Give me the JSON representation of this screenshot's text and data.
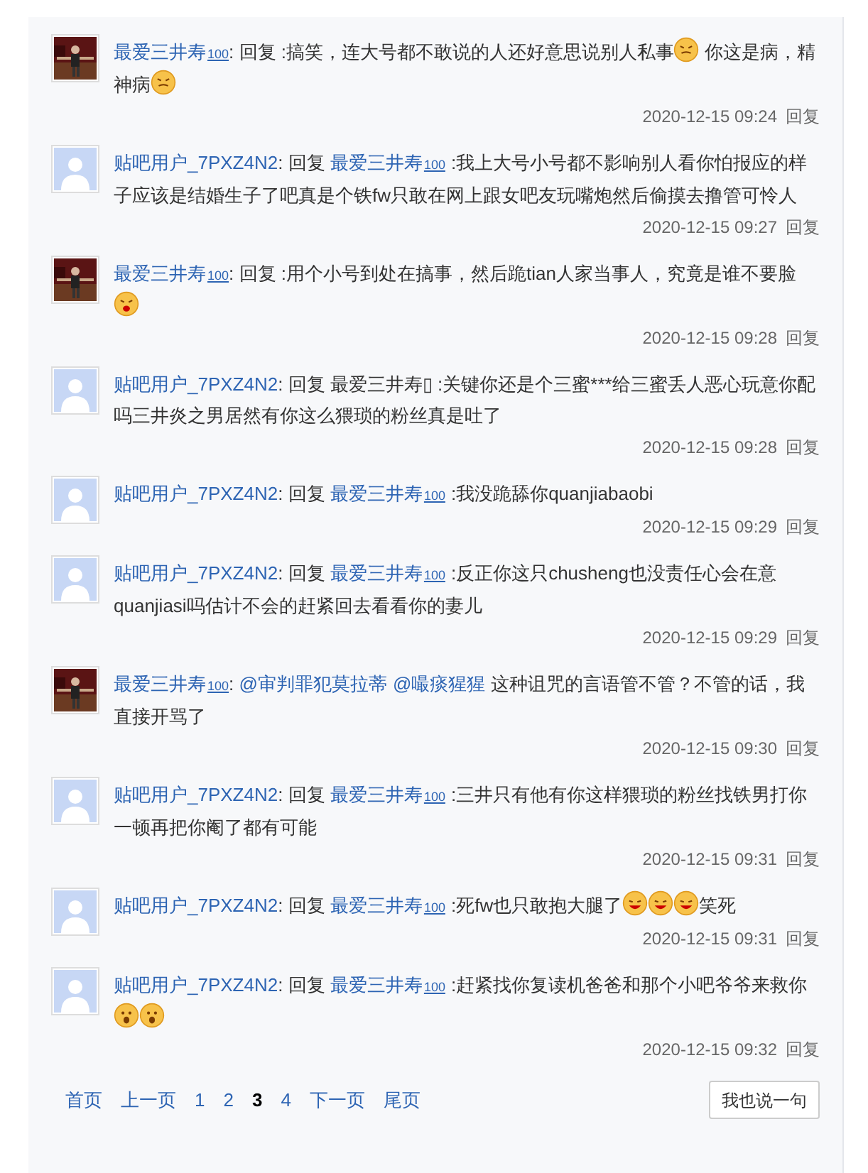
{
  "comments": [
    {
      "author": {
        "name": "最爱三井寿",
        "badge": "100",
        "photo": true
      },
      "content": [
        {
          "kind": "text",
          "text": ": 回复 :搞笑，连大号都不敢说的人还好意思说别人私事"
        },
        {
          "kind": "emoji_angry"
        },
        {
          "kind": "text",
          "text": " 你这是病，精神病"
        },
        {
          "kind": "emoji_angry"
        }
      ],
      "time": "2020-12-15 09:24",
      "reply": "回复"
    },
    {
      "author": {
        "name": "贴吧用户_7PXZ4N2",
        "photo": false
      },
      "content": [
        {
          "kind": "text",
          "text": ": 回复 "
        },
        {
          "kind": "link",
          "text": "最爱三井寿",
          "badge": "100"
        },
        {
          "kind": "text",
          "text": ":我上大号小号都不影响别人看你怕报应的样子应该是结婚生子了吧真是个铁fw只敢在网上跟女吧友玩嘴炮然后偷摸去撸管可怜人"
        }
      ],
      "time": "2020-12-15 09:27",
      "reply": "回复"
    },
    {
      "author": {
        "name": "最爱三井寿",
        "badge": "100",
        "photo": true
      },
      "content": [
        {
          "kind": "text",
          "text": ": 回复 :用个小号到处在搞事，然后跪tian人家当事人，究竟是谁不要脸"
        },
        {
          "kind": "emoji_shout"
        }
      ],
      "time": "2020-12-15 09:28",
      "reply": "回复"
    },
    {
      "author": {
        "name": "贴吧用户_7PXZ4N2",
        "photo": false
      },
      "content": [
        {
          "kind": "text",
          "text": ": 回复 最爱三井寿▯ :关键你还是个三蜜***给三蜜丢人恶心玩意你配吗三井炎之男居然有你这么猥琐的粉丝真是吐了"
        }
      ],
      "time": "2020-12-15 09:28",
      "reply": "回复"
    },
    {
      "author": {
        "name": "贴吧用户_7PXZ4N2",
        "photo": false
      },
      "content": [
        {
          "kind": "text",
          "text": ": 回复 "
        },
        {
          "kind": "link",
          "text": "最爱三井寿",
          "badge": "100"
        },
        {
          "kind": "text",
          "text": ":我没跪舔你quanjiabaobi"
        }
      ],
      "time": "2020-12-15 09:29",
      "reply": "回复"
    },
    {
      "author": {
        "name": "贴吧用户_7PXZ4N2",
        "photo": false
      },
      "content": [
        {
          "kind": "text",
          "text": ": 回复 "
        },
        {
          "kind": "link",
          "text": "最爱三井寿",
          "badge": "100"
        },
        {
          "kind": "text",
          "text": ":反正你这只chusheng也没责任心会在意quanjiasi吗估计不会的赶紧回去看看你的妻儿"
        }
      ],
      "time": "2020-12-15 09:29",
      "reply": "回复"
    },
    {
      "author": {
        "name": "最爱三井寿",
        "badge": "100",
        "photo": true
      },
      "content": [
        {
          "kind": "text",
          "text": ": "
        },
        {
          "kind": "link",
          "text": "@审判罪犯莫拉蒂"
        },
        {
          "kind": "link",
          "text": "@嘬痰猩猩"
        },
        {
          "kind": "text",
          "text": "这种诅咒的言语管不管？不管的话，我直接开骂了"
        }
      ],
      "time": "2020-12-15 09:30",
      "reply": "回复"
    },
    {
      "author": {
        "name": "贴吧用户_7PXZ4N2",
        "photo": false
      },
      "content": [
        {
          "kind": "text",
          "text": ": 回复 "
        },
        {
          "kind": "link",
          "text": "最爱三井寿",
          "badge": "100"
        },
        {
          "kind": "text",
          "text": ":三井只有他有你这样猥琐的粉丝找铁男打你一顿再把你阉了都有可能"
        }
      ],
      "time": "2020-12-15 09:31",
      "reply": "回复"
    },
    {
      "author": {
        "name": "贴吧用户_7PXZ4N2",
        "photo": false
      },
      "content": [
        {
          "kind": "text",
          "text": ": 回复 "
        },
        {
          "kind": "link",
          "text": "最爱三井寿",
          "badge": "100"
        },
        {
          "kind": "text",
          "text": ":死fw也只敢抱大腿了"
        },
        {
          "kind": "emoji_laugh"
        },
        {
          "kind": "emoji_laugh"
        },
        {
          "kind": "emoji_laugh"
        },
        {
          "kind": "text",
          "text": "笑死"
        }
      ],
      "time": "2020-12-15 09:31",
      "reply": "回复"
    },
    {
      "author": {
        "name": "贴吧用户_7PXZ4N2",
        "photo": false
      },
      "content": [
        {
          "kind": "text",
          "text": ": 回复 "
        },
        {
          "kind": "link",
          "text": "最爱三井寿",
          "badge": "100"
        },
        {
          "kind": "text",
          "text": ":赶紧找你复读机爸爸和那个小吧爷爷来救你"
        },
        {
          "kind": "emoji_wow"
        },
        {
          "kind": "emoji_wow"
        }
      ],
      "time": "2020-12-15 09:32",
      "reply": "回复"
    }
  ],
  "pagination": [
    {
      "label": "首页",
      "selected": false
    },
    {
      "label": "上一页",
      "selected": false
    },
    {
      "label": "1",
      "selected": false
    },
    {
      "label": "2",
      "selected": false
    },
    {
      "label": "3",
      "selected": true
    },
    {
      "label": "4",
      "selected": false
    },
    {
      "label": "下一页",
      "selected": false
    },
    {
      "label": "尾页",
      "selected": false
    }
  ],
  "reply_button": "我也说一句"
}
